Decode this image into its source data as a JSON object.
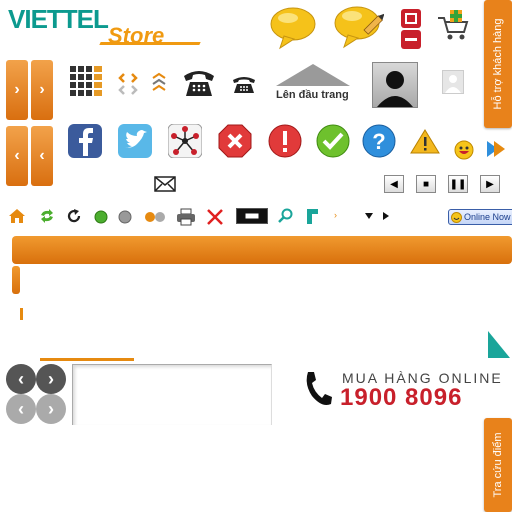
{
  "brand": {
    "viettel": "VIETTEL",
    "store": "Store",
    "colors": {
      "teal": "#0c9a8f",
      "orange": "#f09a11",
      "red": "#c8202b"
    }
  },
  "side_tabs": {
    "support": "Hỗ trợ khách hàng",
    "points": "Tra cứu điểm"
  },
  "top_link": "Lên đầu trang",
  "online_badge": "Online Now",
  "hotline": {
    "label": "MUA HÀNG ONLINE",
    "number": "1900 8096"
  },
  "icons": [
    "speech-bubble-icon",
    "edit-bubble-icon",
    "grid-plus-minus-icon",
    "cart-add-icon",
    "grid-view-icon",
    "diamond-arrows-icon",
    "double-chevron-icon",
    "phone-icon",
    "phone-small-icon",
    "up-arrow-icon",
    "user-avatar-icon",
    "user-avatar-small-icon",
    "facebook-icon",
    "twitter-icon",
    "share-icon",
    "error-icon",
    "warning-icon",
    "check-icon",
    "help-icon",
    "alert-icon",
    "smiley-icon",
    "play-forward-icon",
    "mail-icon",
    "home-icon",
    "refresh-icon",
    "reload-icon",
    "green-dot-icon",
    "gray-dot-icon",
    "flickr-icon",
    "print-icon",
    "close-x-icon",
    "minimize-icon",
    "search-icon",
    "arrow-down-right-icon"
  ]
}
